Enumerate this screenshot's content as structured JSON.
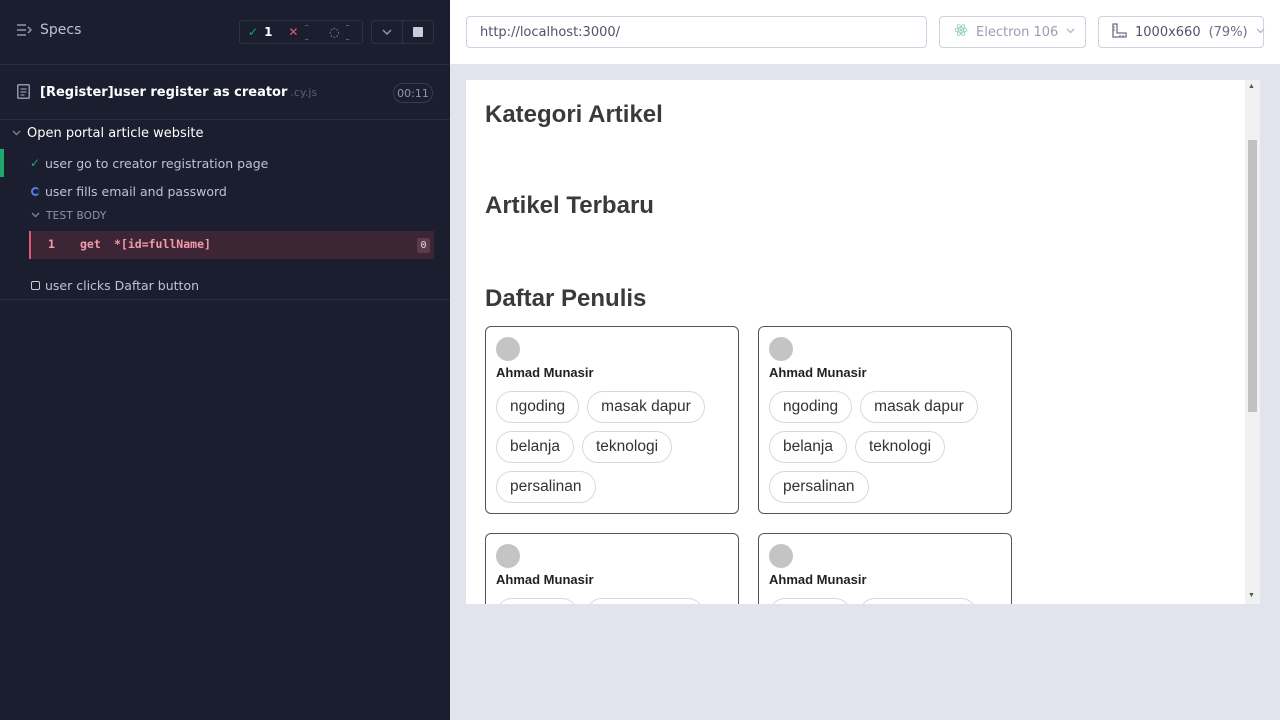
{
  "reporter": {
    "specs_label": "Specs",
    "stats": {
      "passed": "1",
      "failed": "--",
      "pending": "--"
    },
    "spec": {
      "name": "[Register]user register as creator",
      "ext": ".cy.js",
      "duration": "00:11"
    },
    "suite": {
      "title": "Open portal article website"
    },
    "tests": [
      {
        "title": "user go to creator registration page",
        "state": "passed"
      },
      {
        "title": "user fills email and password",
        "state": "running"
      },
      {
        "title": "user clicks Daftar button",
        "state": "pending"
      }
    ],
    "test_body_label": "TEST BODY",
    "command": {
      "number": "1",
      "name": "get",
      "selector": "*[id=fullName]",
      "count": "0"
    }
  },
  "aut": {
    "url": "http://localhost:3000/",
    "browser": "Electron 106",
    "viewport": "1000x660",
    "scale": "(79%)",
    "page": {
      "headings": [
        "Kategori Artikel",
        "Artikel Terbaru",
        "Daftar Penulis"
      ],
      "authors": [
        {
          "name": "Ahmad Munasir",
          "tags": [
            "ngoding",
            "masak dapur",
            "belanja",
            "teknologi",
            "persalinan"
          ]
        },
        {
          "name": "Ahmad Munasir",
          "tags": [
            "ngoding",
            "masak dapur",
            "belanja",
            "teknologi",
            "persalinan"
          ]
        },
        {
          "name": "Ahmad Munasir"
        },
        {
          "name": "Ahmad Munasir"
        }
      ]
    }
  },
  "colors": {
    "pass": "#1fa971",
    "fail": "#e45770",
    "running": "#4e7ef2",
    "reporter_bg": "#1b1e2e"
  }
}
